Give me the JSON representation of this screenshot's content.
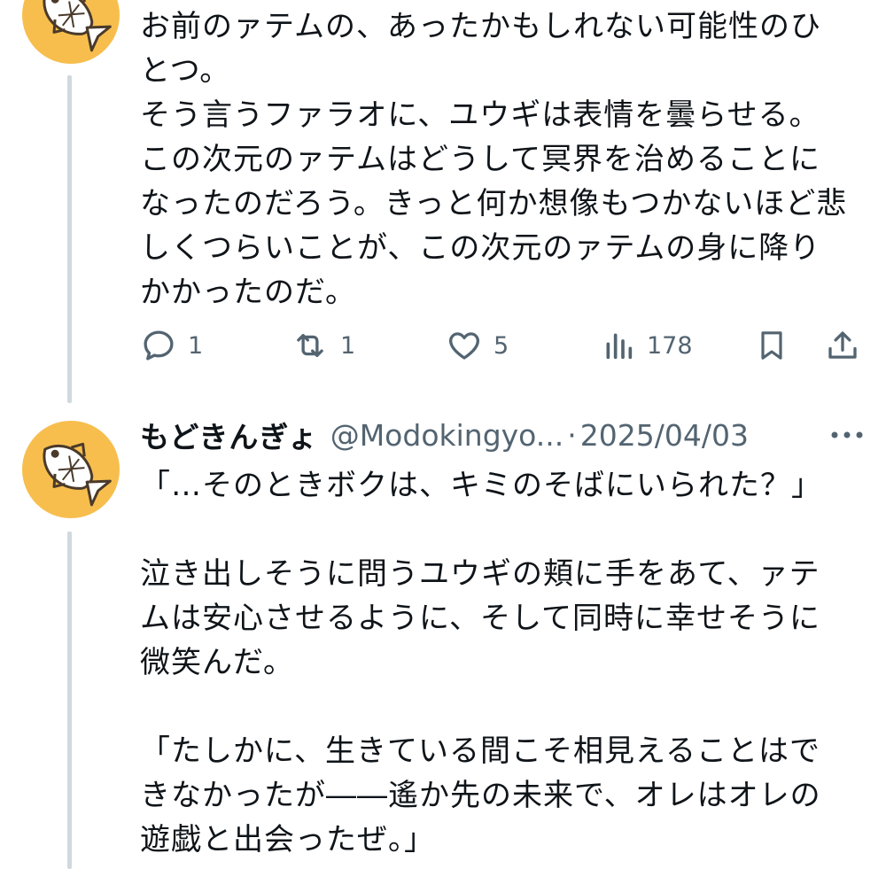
{
  "tweet1": {
    "text": "お前のァテムの、あったかもしれない可能性のひとつ。\nそう言うファラオに、ユウギは表情を曇らせる。この次元のァテムはどうして冥界を治めることになったのだろう。きっと何か想像もつかないほど悲しくつらいことが、この次元のァテムの身に降りかかったのだ。",
    "replies": "1",
    "reposts": "1",
    "likes": "5",
    "views": "178"
  },
  "tweet2": {
    "display_name": "もどきんぎょ",
    "handle": "@Modokingyo...",
    "separator": "·",
    "date": "2025/04/03",
    "text": "「…そのときボクは、キミのそばにいられた？」\n\n泣き出しそうに問うユウギの頬に手をあて、ァテムは安心させるように、そして同時に幸せそうに微笑んだ。\n\n「たしかに、生きている間こそ相見えることはできなかったが――遙か先の未来で、オレはオレの遊戯と出会ったぜ。」"
  },
  "colors": {
    "avatar_bg": "#f7be4e",
    "thread_line": "#cfd9de",
    "secondary_text": "#536471"
  },
  "icons": [
    "fish-avatar-icon",
    "reply-icon",
    "repost-icon",
    "like-icon",
    "views-icon",
    "bookmark-icon",
    "share-icon",
    "more-icon"
  ]
}
